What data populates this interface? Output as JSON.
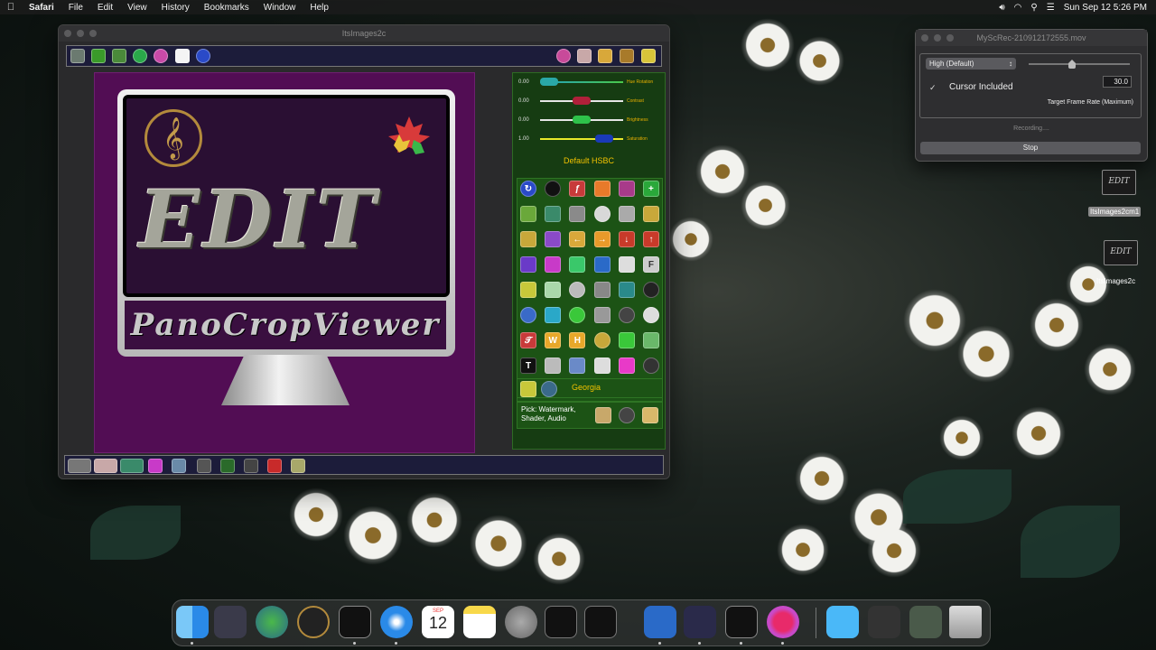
{
  "menubar": {
    "app": "Safari",
    "items": [
      "File",
      "Edit",
      "View",
      "History",
      "Bookmarks",
      "Window",
      "Help"
    ],
    "clock": "Sun Sep 12  5:26 PM"
  },
  "app_window": {
    "title": "ItsImages2c",
    "logo_title": "EDIT",
    "logo_subtitle": "PanoCropViewer",
    "sliders": [
      {
        "value": "0.00",
        "label": "Hue Rotation",
        "knob_color": "#2aa8a8",
        "level": 0.0
      },
      {
        "value": "0.00",
        "label": "Contrast",
        "knob_color": "#b0203a",
        "level": 0.5
      },
      {
        "value": "0.00",
        "label": "Brightness",
        "knob_color": "#2ec24a",
        "level": 0.5
      },
      {
        "value": "1.00",
        "label": "Saturation",
        "knob_color": "#1a3ab8",
        "level": 0.85
      }
    ],
    "hsbc_label": "Default HSBC",
    "font_name": "Georgia",
    "pick_label": "Pick: Watermark, Shader, Audio",
    "text_glyphs": {
      "w": "W",
      "h": "H",
      "t": "T",
      "f": "F"
    }
  },
  "recorder": {
    "title": "MyScRec-210912172555.mov",
    "quality": "High (Default)",
    "cursor_label": "Cursor Included",
    "checkmark": "✓",
    "fps": "30.0",
    "target_label": "Target Frame Rate (Maximum)",
    "status": "Recording....",
    "stop_label": "Stop"
  },
  "desktop": {
    "icon1_label": "ItsImages2cm1",
    "icon2_label": "ItsImages2c"
  },
  "dock": {
    "calendar_month": "SEP",
    "calendar_day": "12"
  }
}
